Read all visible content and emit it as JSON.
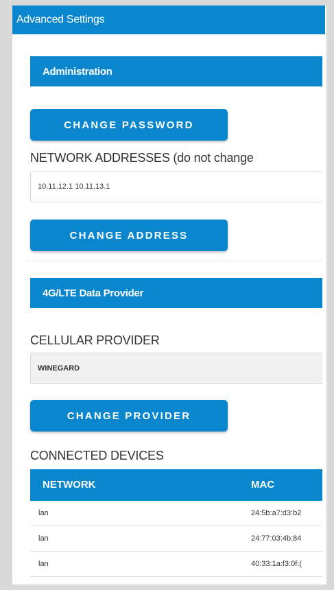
{
  "header": {
    "title": "Advanced Settings"
  },
  "administration": {
    "section_title": "Administration",
    "change_password_label": "CHANGE PASSWORD",
    "network_addresses_label": "NETWORK ADDRESSES (do not change",
    "network_addresses_value": "10.11.12.1  10.11.13.1",
    "change_address_label": "CHANGE ADDRESS"
  },
  "data_provider": {
    "section_title": "4G/LTE Data Provider",
    "cellular_provider_label": "CELLULAR PROVIDER",
    "cellular_provider_value": "WINEGARD",
    "change_provider_label": "CHANGE PROVIDER"
  },
  "devices": {
    "title": "CONNECTED DEVICES",
    "columns": [
      "NETWORK",
      "MAC"
    ],
    "rows": [
      {
        "network": "lan",
        "mac": "24:5b:a7:d3:b2"
      },
      {
        "network": "lan",
        "mac": "24:77:03:4b:84"
      },
      {
        "network": "lan",
        "mac": "40:33:1a:f3:0f:("
      }
    ]
  },
  "colors": {
    "accent": "#0a86cf",
    "background": "#d9d9d9"
  }
}
